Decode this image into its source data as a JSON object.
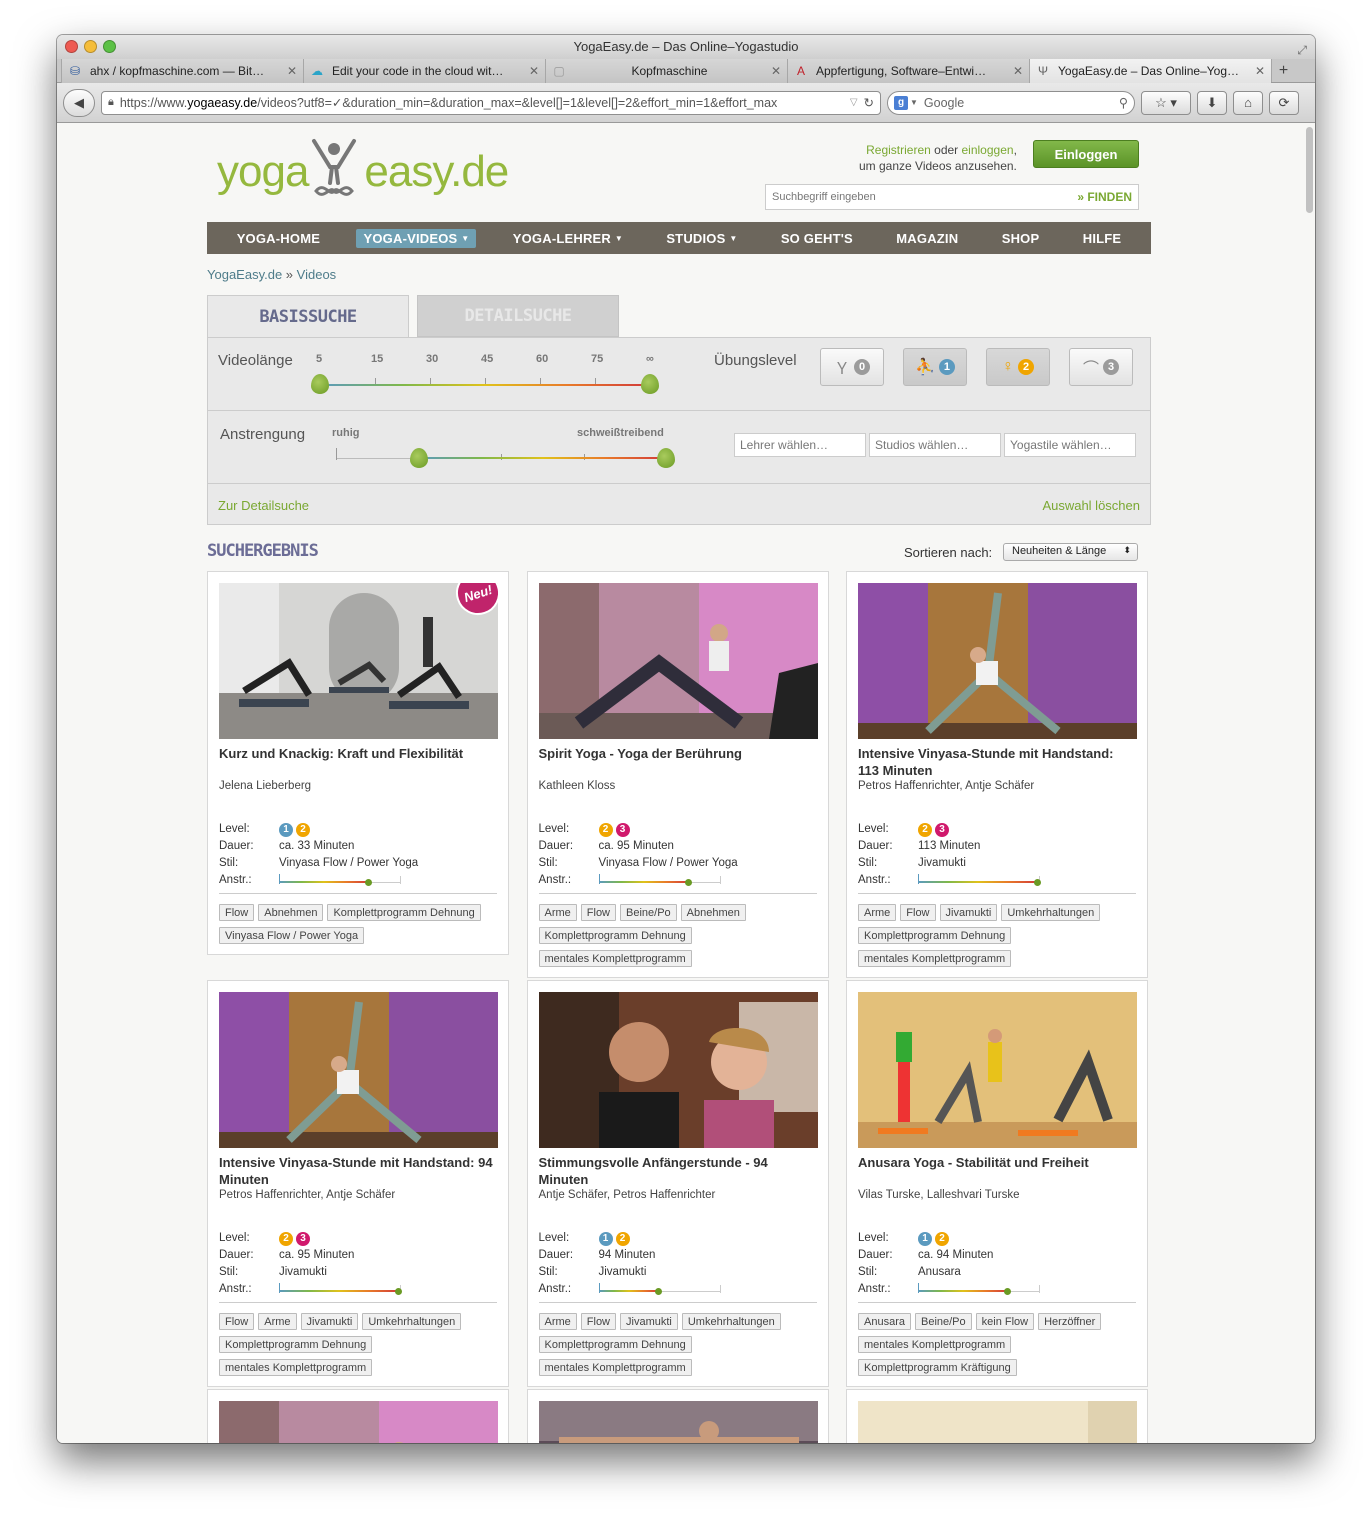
{
  "window": {
    "title": "YogaEasy.de – Das Online–Yogastudio"
  },
  "tabs": [
    {
      "label": "ahx / kopfmaschine.com — Bit…",
      "icon": "bitbucket-icon"
    },
    {
      "label": "Edit your code in the cloud wit…",
      "icon": "cloud-icon"
    },
    {
      "label": "Kopfmaschine",
      "icon": "blank-page-icon"
    },
    {
      "label": "Appfertigung, Software–Entwi…",
      "icon": "a-logo-icon"
    },
    {
      "label": "YogaEasy.de – Das Online–Yog…",
      "icon": "yogaeasy-icon"
    }
  ],
  "browser": {
    "url_prefix": "https://www.",
    "url_domain": "yogaeasy.de",
    "url_rest": "/videos?utf8=✓&duration_min=&duration_max=&level[]=1&level[]=2&effort_min=1&effort_max",
    "search_placeholder": "Google"
  },
  "site": {
    "logo_left": "yoga",
    "logo_right": "easy.de",
    "reg_register": "Registrieren",
    "reg_or": " oder ",
    "reg_login": "einloggen",
    "reg_line2": "um ganze Videos anzusehen.",
    "login_button": "Einloggen",
    "search_placeholder": "Suchbegriff eingeben",
    "search_button": "» FINDEN"
  },
  "nav": [
    {
      "label": "YOGA-HOME",
      "active": false,
      "dropdown": false
    },
    {
      "label": "YOGA-VIDEOS",
      "active": true,
      "dropdown": true
    },
    {
      "label": "YOGA-LEHRER",
      "active": false,
      "dropdown": true
    },
    {
      "label": "STUDIOS",
      "active": false,
      "dropdown": true
    },
    {
      "label": "SO GEHT'S",
      "active": false,
      "dropdown": false
    },
    {
      "label": "MAGAZIN",
      "active": false,
      "dropdown": false
    },
    {
      "label": "SHOP",
      "active": false,
      "dropdown": false
    },
    {
      "label": "HILFE",
      "active": false,
      "dropdown": false
    }
  ],
  "breadcrumb": {
    "home": "YogaEasy.de",
    "sep": " » ",
    "current": "Videos"
  },
  "search_tabs": {
    "basic": "BASISSUCHE",
    "detail": "DETAILSUCHE"
  },
  "filters": {
    "duration_label": "Videolänge",
    "duration_ticks": [
      "5",
      "15",
      "30",
      "45",
      "60",
      "75",
      "∞"
    ],
    "level_label": "Übungslevel",
    "levels": [
      {
        "num": "0",
        "color": "#9b9b9b",
        "selected": false
      },
      {
        "num": "1",
        "color": "#5b9abf",
        "selected": true
      },
      {
        "num": "2",
        "color": "#f0a500",
        "selected": true
      },
      {
        "num": "3",
        "color": "#9b9b9b",
        "selected": false
      }
    ],
    "effort_label": "Anstrengung",
    "effort_min_label": "ruhig",
    "effort_max_label": "schweißtreibend",
    "teacher_placeholder": "Lehrer wählen…",
    "studio_placeholder": "Studios wählen…",
    "style_placeholder": "Yogastile wählen…",
    "detail_link": "Zur Detailsuche",
    "clear_link": "Auswahl löschen"
  },
  "results": {
    "heading": "SUCHERGEBNIS",
    "sort_label": "Sortieren nach:",
    "sort_value": "Neuheiten & Länge",
    "labels": {
      "level": "Level:",
      "duration": "Dauer:",
      "style": "Stil:",
      "effort": "Anstr.:"
    },
    "new_badge": "Neu!",
    "videos": [
      {
        "title": "Kurz und Knackig: Kraft und Flexibilität",
        "authors": "Jelena Lieberberg",
        "levels": [
          "1",
          "2"
        ],
        "duration": "ca. 33 Minuten",
        "style": "Vinyasa Flow / Power Yoga",
        "effort": 0.75,
        "is_new": true,
        "tags": [
          "Flow",
          "Abnehmen",
          "Komplettprogramm Dehnung",
          "Vinyasa Flow / Power Yoga"
        ],
        "scene": "studio-bright"
      },
      {
        "title": "Spirit Yoga - Yoga der Berührung",
        "authors": "Kathleen Kloss",
        "levels": [
          "2",
          "3"
        ],
        "duration": "ca. 95 Minuten",
        "style": "Vinyasa Flow / Power Yoga",
        "effort": 0.75,
        "is_new": false,
        "tags": [
          "Arme",
          "Flow",
          "Beine/Po",
          "Abnehmen",
          "Komplettprogramm Dehnung",
          "mentales Komplettprogramm"
        ],
        "scene": "pink-room"
      },
      {
        "title": "Intensive Vinyasa-Stunde mit Handstand: 113 Minuten",
        "authors": "Petros Haffenrichter, Antje Schäfer",
        "levels": [
          "2",
          "3"
        ],
        "duration": "113 Minuten",
        "style": "Jivamukti",
        "effort": 1.0,
        "is_new": false,
        "tags": [
          "Arme",
          "Flow",
          "Jivamukti",
          "Umkehrhaltungen",
          "Komplettprogramm Dehnung",
          "mentales Komplettprogramm"
        ],
        "scene": "purple-room"
      },
      {
        "title": "Intensive Vinyasa-Stunde mit Handstand: 94 Minuten",
        "authors": "Petros Haffenrichter, Antje Schäfer",
        "levels": [
          "2",
          "3"
        ],
        "duration": "ca. 95 Minuten",
        "style": "Jivamukti",
        "effort": 1.0,
        "is_new": false,
        "tags": [
          "Flow",
          "Arme",
          "Jivamukti",
          "Umkehrhaltungen",
          "Komplettprogramm Dehnung",
          "mentales Komplettprogramm"
        ],
        "scene": "purple-room"
      },
      {
        "title": "Stimmungsvolle Anfängerstunde - 94 Minuten",
        "authors": "Antje Schäfer, Petros Haffenrichter",
        "levels": [
          "1",
          "2"
        ],
        "duration": "94 Minuten",
        "style": "Jivamukti",
        "effort": 0.5,
        "is_new": false,
        "tags": [
          "Arme",
          "Flow",
          "Jivamukti",
          "Umkehrhaltungen",
          "Komplettprogramm Dehnung",
          "mentales Komplettprogramm"
        ],
        "scene": "portrait"
      },
      {
        "title": "Anusara Yoga - Stabilität und Freiheit",
        "authors": "Vilas Turske, Lalleshvari Turske",
        "levels": [
          "1",
          "2"
        ],
        "duration": "ca. 94 Minuten",
        "style": "Anusara",
        "effort": 0.75,
        "is_new": false,
        "tags": [
          "Anusara",
          "Beine/Po",
          "kein Flow",
          "Herzöffner",
          "mentales Komplettprogramm",
          "Komplettprogramm Kräftigung"
        ],
        "scene": "group-class"
      },
      {
        "title": "",
        "authors": "",
        "levels": [],
        "duration": "",
        "style": "",
        "effort": 0,
        "is_new": false,
        "tags": [],
        "scene": "pink-room"
      },
      {
        "title": "",
        "authors": "",
        "levels": [],
        "duration": "",
        "style": "",
        "effort": 0,
        "is_new": false,
        "tags": [],
        "scene": "dark-arms"
      },
      {
        "title": "",
        "authors": "",
        "levels": [],
        "duration": "",
        "style": "",
        "effort": 0,
        "is_new": false,
        "tags": [],
        "scene": "cream"
      }
    ]
  },
  "colors": {
    "accent_green": "#7aa832",
    "nav_bg": "#6c665c",
    "nav_active": "#6fa0b3",
    "heading_purple": "#6c6d96",
    "level1": "#5b9abf",
    "level2": "#f0a500",
    "level3": "#d0196c"
  }
}
